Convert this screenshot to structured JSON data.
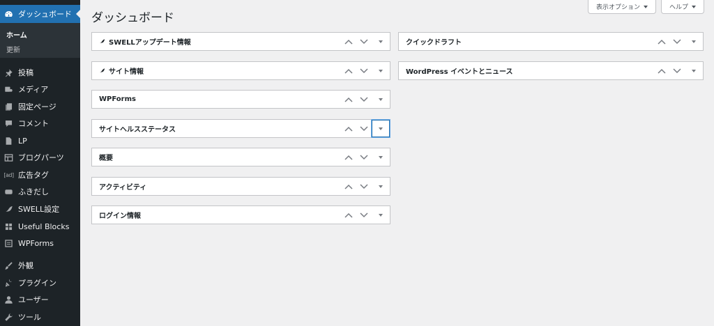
{
  "sidebar": {
    "dashboard_label": "ダッシュボード",
    "sub_home": "ホーム",
    "sub_update": "更新",
    "items": [
      {
        "label": "投稿",
        "icon": "pin-icon"
      },
      {
        "label": "メディア",
        "icon": "media-icon"
      },
      {
        "label": "固定ページ",
        "icon": "page-icon"
      },
      {
        "label": "コメント",
        "icon": "comment-icon"
      },
      {
        "label": "LP",
        "icon": "document-icon"
      },
      {
        "label": "ブログパーツ",
        "icon": "table-icon"
      },
      {
        "label": "広告タグ",
        "icon": "ad-icon",
        "icon_text": "[ad]"
      },
      {
        "label": "ふきだし",
        "icon": "speech-icon"
      },
      {
        "label": "SWELL設定",
        "icon": "swell-icon"
      },
      {
        "label": "Useful Blocks",
        "icon": "blocks-icon"
      },
      {
        "label": "WPForms",
        "icon": "form-icon"
      },
      {
        "label": "外観",
        "icon": "brush-icon"
      },
      {
        "label": "プラグイン",
        "icon": "plugin-icon"
      },
      {
        "label": "ユーザー",
        "icon": "user-icon"
      },
      {
        "label": "ツール",
        "icon": "wrench-icon"
      }
    ]
  },
  "header": {
    "title": "ダッシュボード",
    "screen_options": "表示オプション",
    "help": "ヘルプ"
  },
  "widgets_left": [
    {
      "title": "SWELLアップデート情報",
      "icon": "swell-icon"
    },
    {
      "title": "サイト情報",
      "icon": "swell-icon"
    },
    {
      "title": "WPForms"
    },
    {
      "title": "サイトヘルスステータス"
    },
    {
      "title": "概要"
    },
    {
      "title": "アクティビティ"
    },
    {
      "title": "ログイン情報"
    }
  ],
  "widgets_right": [
    {
      "title": "クイックドラフト"
    },
    {
      "title": "WordPress イベントとニュース"
    }
  ],
  "colors": {
    "sidebar_bg": "#1d2327",
    "accent": "#2271b1",
    "page_bg": "#f0f0f1"
  }
}
